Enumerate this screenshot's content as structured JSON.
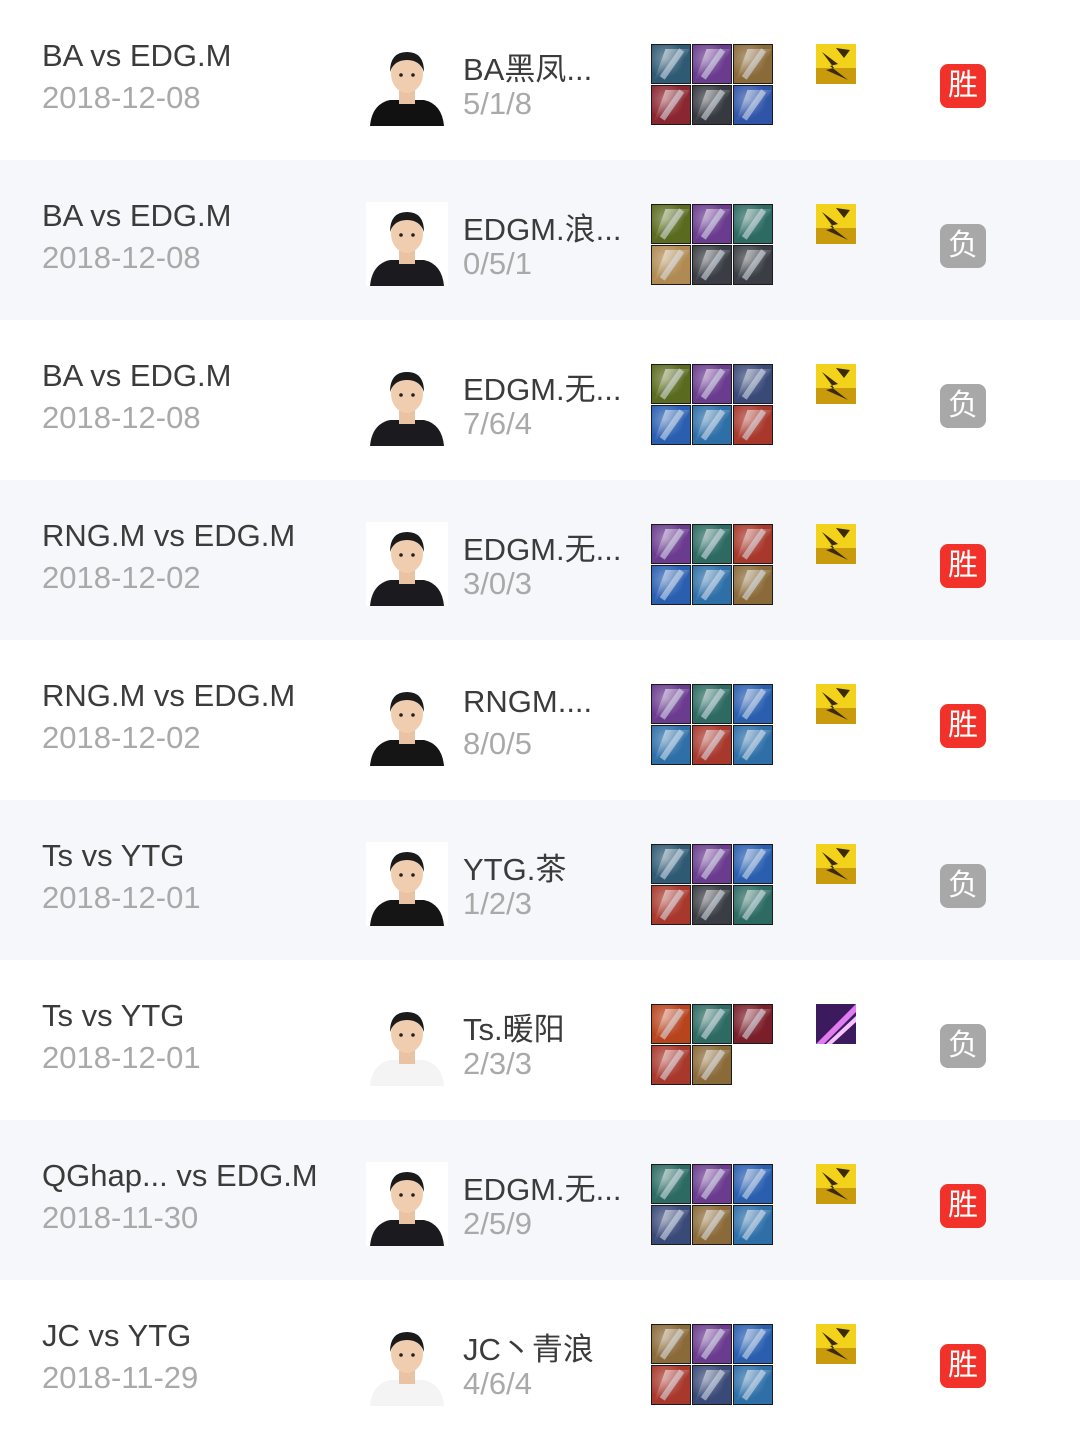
{
  "colors": {
    "win": "#f2312a",
    "loss": "#a8a8a8",
    "title_text": "#3b3b3b",
    "secondary_text": "#a9a9a9",
    "alt_row_bg": "#f5f7fa"
  },
  "matches": [
    {
      "title": "BA vs EDG.M",
      "date": "2018-12-08",
      "player": "BA黑凤...",
      "kda": "5/1/8",
      "result": "胜",
      "outcome": "win",
      "avatar_shirt": "#111111",
      "avatar_bg": "#ffffff",
      "items": [
        "#2f5a74",
        "#6a3b8f",
        "#8a6a38",
        "#8a2630",
        "#36393f",
        "#3055a8"
      ],
      "spell": "flash-spell-icon"
    },
    {
      "title": "BA vs EDG.M",
      "date": "2018-12-08",
      "player": "EDGM.浪...",
      "kda": "0/5/1",
      "result": "负",
      "outcome": "loss",
      "avatar_shirt": "#1b1b1f",
      "avatar_bg": "#ffffff",
      "items": [
        "#5a6b1f",
        "#6a3b8f",
        "#2c6a62",
        "#b08a52",
        "#3a3d43",
        "#3a3d43"
      ],
      "spell": "flash-spell-icon"
    },
    {
      "title": "BA vs EDG.M",
      "date": "2018-12-08",
      "player": "EDGM.无...",
      "kda": "7/6/4",
      "result": "负",
      "outcome": "loss",
      "avatar_shirt": "#1b1b1f",
      "avatar_bg": "#ffffff",
      "items": [
        "#5a6b1f",
        "#6a3b8f",
        "#3a4a78",
        "#2a5fb0",
        "#2e6fa8",
        "#a8382c"
      ],
      "spell": "flash-spell-icon"
    },
    {
      "title": "RNG.M vs EDG.M",
      "date": "2018-12-02",
      "player": "EDGM.无...",
      "kda": "3/0/3",
      "result": "胜",
      "outcome": "win",
      "avatar_shirt": "#1b1b1f",
      "avatar_bg": "#ffffff",
      "items": [
        "#6a3b8f",
        "#2c6a62",
        "#a8382c",
        "#2a5fb0",
        "#2e6fa8",
        "#8a6a38"
      ],
      "spell": "flash-spell-icon"
    },
    {
      "title": "RNG.M vs EDG.M",
      "date": "2018-12-02",
      "player": "RNGM....",
      "kda": "8/0/5",
      "result": "胜",
      "outcome": "win",
      "avatar_shirt": "#151515",
      "avatar_bg": "#ffffff",
      "items": [
        "#6a3b8f",
        "#2c6a62",
        "#2a5fb0",
        "#2e6fa8",
        "#a8382c",
        "#2e6fa8"
      ],
      "spell": "flash-spell-icon"
    },
    {
      "title": "Ts vs YTG",
      "date": "2018-12-01",
      "player": "YTG.茶",
      "kda": "1/2/3",
      "result": "负",
      "outcome": "loss",
      "avatar_shirt": "#151515",
      "avatar_bg": "#ffffff",
      "items": [
        "#2f5a74",
        "#6a3b8f",
        "#2a5fb0",
        "#a8382c",
        "#3a3d43",
        "#2c6a62"
      ],
      "spell": "flash-spell-icon"
    },
    {
      "title": "Ts vs YTG",
      "date": "2018-12-01",
      "player": "Ts.暖阳",
      "kda": "2/3/3",
      "result": "负",
      "outcome": "loss",
      "avatar_shirt": "#f4f4f4",
      "avatar_bg": "#ffffff",
      "items": [
        "#b8441e",
        "#2c6a62",
        "#7a1f2a",
        "#a8382c",
        "#8a6a38",
        ""
      ],
      "spell": "smite-spell-icon"
    },
    {
      "title": "QGhap... vs EDG.M",
      "date": "2018-11-30",
      "player": "EDGM.无...",
      "kda": "2/5/9",
      "result": "胜",
      "outcome": "win",
      "avatar_shirt": "#1b1b1f",
      "avatar_bg": "#ffffff",
      "items": [
        "#2c6a62",
        "#6a3b8f",
        "#2a5fb0",
        "#3a4a78",
        "#8a6a38",
        "#2e6fa8"
      ],
      "spell": "flash-spell-icon"
    },
    {
      "title": "JC vs YTG",
      "date": "2018-11-29",
      "player": "JC丶青浪",
      "kda": "4/6/4",
      "result": "胜",
      "outcome": "win",
      "avatar_shirt": "#f4f4f4",
      "avatar_bg": "#ffffff",
      "items": [
        "#8a6a38",
        "#6a3b8f",
        "#2a5fb0",
        "#a8382c",
        "#3a4a78",
        "#2e6fa8"
      ],
      "spell": "flash-spell-icon"
    }
  ]
}
